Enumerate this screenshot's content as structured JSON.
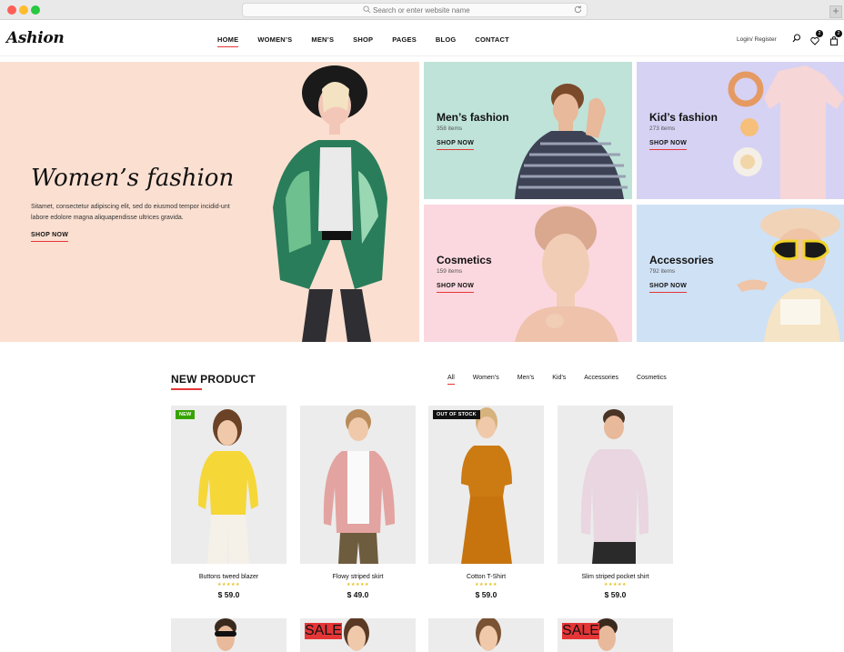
{
  "browser": {
    "url_placeholder": "Search or enter website name"
  },
  "header": {
    "logo": "Ashion",
    "nav": [
      "HOME",
      "WOMEN’S",
      "MEN’S",
      "SHOP",
      "PAGES",
      "BLOG",
      "CONTACT"
    ],
    "auth_label": "Login/ Register",
    "wishlist_count": "2",
    "cart_count": "2"
  },
  "hero": {
    "title": "Women’s fashion",
    "description": "Sitamet, consectetur adipiscing elit, sed do eiusmod tempor incidid-unt labore edolore magna aliquapendisse ultrices gravida.",
    "cta": "SHOP NOW"
  },
  "categories": [
    {
      "title": "Men’s fashion",
      "count": "358 items",
      "cta": "SHOP NOW",
      "bg": "#bfe3d8"
    },
    {
      "title": "Kid’s fashion",
      "count": "273 items",
      "cta": "SHOP NOW",
      "bg": "#d6d2f4"
    },
    {
      "title": "Cosmetics",
      "count": "159 items",
      "cta": "SHOP NOW",
      "bg": "#fbd8e0"
    },
    {
      "title": "Accessories",
      "count": "792 items",
      "cta": "SHOP NOW",
      "bg": "#cfe1f5"
    }
  ],
  "new_product": {
    "title": "NEW PRODUCT",
    "filters": [
      "All",
      "Women’s",
      "Men’s",
      "Kid’s",
      "Accessories",
      "Cosmetics"
    ],
    "products": [
      {
        "name": "Buttons tweed blazer",
        "price": "$ 59.0",
        "tag": "NEW",
        "rating": "★★★★★"
      },
      {
        "name": "Flowy striped skirt",
        "price": "$ 49.0",
        "tag": "",
        "rating": "★★★★★"
      },
      {
        "name": "Cotton T-Shirt",
        "price": "$ 59.0",
        "tag": "OUT OF STOCK",
        "rating": "★★★★★"
      },
      {
        "name": "Slim striped pocket shirt",
        "price": "$ 59.0",
        "tag": "",
        "rating": "★★★★★"
      }
    ],
    "row2_tags": [
      "",
      "SALE",
      "",
      "SALE"
    ]
  },
  "colors": {
    "accent": "#e53637",
    "hero_bg": "#fbe0d2",
    "new_tag": "#36a300"
  }
}
